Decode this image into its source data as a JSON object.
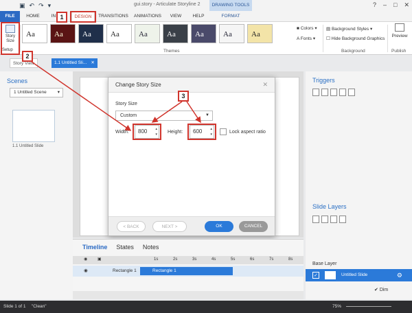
{
  "window": {
    "title": "gui.story - Articulate Storyline 2",
    "context_tab": "DRAWING TOOLS"
  },
  "tabs": [
    "FILE",
    "HOME",
    "IN",
    "DESIGN",
    "TRANSITIONS",
    "ANIMATIONS",
    "VIEW",
    "HELP",
    "FORMAT"
  ],
  "ribbon": {
    "story_size": "Story Size",
    "setup": "Setup",
    "theme_label": "Aa",
    "themes_group": "Themes",
    "colors": "Colors",
    "fonts": "Fonts",
    "background_styles": "Background Styles",
    "hide_background": "Hide Background Graphics",
    "background_group": "Background",
    "preview": "Preview",
    "publish": "Publish"
  },
  "doc_tabs": {
    "story_view": "Story View",
    "slide": "1.1 Untitled Sli..."
  },
  "scenes": {
    "title": "Scenes",
    "selected": "1 Untitled Scene",
    "thumb_label": "1.1 Untitled Slide"
  },
  "dialog": {
    "title": "Change Story Size",
    "story_size_label": "Story Size",
    "preset": "Custom",
    "width_label": "Width:",
    "width_value": "800",
    "height_label": "Height:",
    "height_value": "600",
    "lock_label": "Lock aspect ratio",
    "back": "< BACK",
    "next": "NEXT >",
    "ok": "OK",
    "cancel": "CANCEL"
  },
  "annotations": [
    "1",
    "2",
    "3"
  ],
  "timeline": {
    "tabs": [
      "Timeline",
      "States",
      "Notes"
    ],
    "ticks": [
      "1s",
      "2s",
      "3s",
      "4s",
      "5s",
      "6s",
      "7s",
      "8s"
    ],
    "row_name": "Rectangle 1",
    "bar_label": "Rectangle 1"
  },
  "right": {
    "triggers": "Triggers",
    "slide_layers": "Slide Layers",
    "base_layer": "Base Layer",
    "layer_name": "Untitled Slide",
    "dim": "Dim"
  },
  "status": {
    "slide": "Slide 1 of 1",
    "theme": "\"Clean\"",
    "zoom": "75%"
  },
  "colors": {
    "accent": "#2b7ad9",
    "annotation": "#d0342c"
  }
}
